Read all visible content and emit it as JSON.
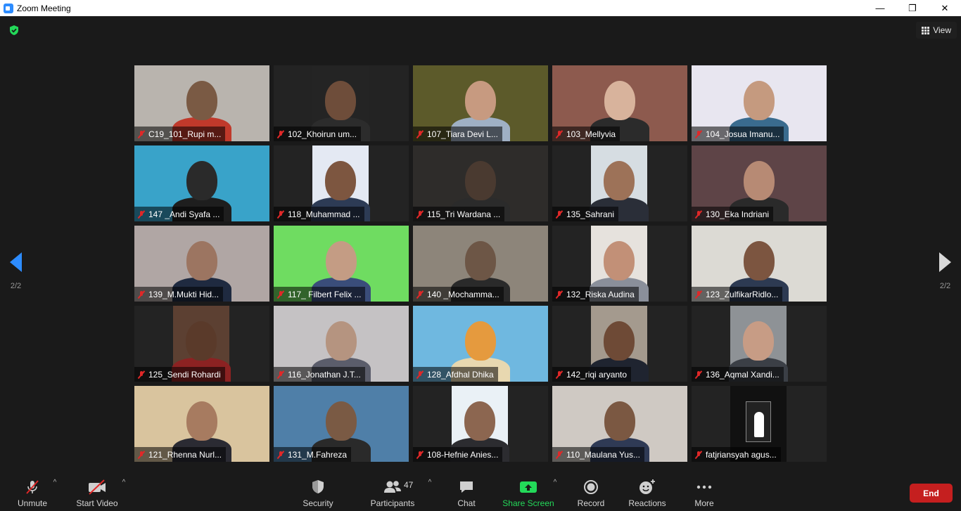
{
  "window": {
    "title": "Zoom Meeting",
    "minimize": "—",
    "restore": "❐",
    "close": "✕"
  },
  "top": {
    "view_label": "View"
  },
  "pagination": {
    "left": "2/2",
    "right": "2/2"
  },
  "participants": [
    {
      "name": "C19_101_Rupi m...",
      "bg": "#b9b4ae",
      "skin": "#7a5a44",
      "shirt": "#c0392b"
    },
    {
      "name": "102_Khoirun um...",
      "bg": "#242424",
      "skin": "#6e4d3a",
      "shirt": "#2c2c2c",
      "narrow": true
    },
    {
      "name": "107_Tiara Devi L...",
      "bg": "#5c5a2a",
      "skin": "#c79a80",
      "shirt": "#9fb0c4"
    },
    {
      "name": "103_Mellyvia",
      "bg": "#8d5a4e",
      "skin": "#d8b39c",
      "shirt": "#2b2b2b"
    },
    {
      "name": "104_Josua Imanu...",
      "bg": "#e8e6f0",
      "skin": "#c59a7f",
      "shirt": "#3a6b8e"
    },
    {
      "name": "147 _Andi Syafa ...",
      "bg": "#39a3c9",
      "skin": "#2a2a2a",
      "shirt": "#1e1e1e"
    },
    {
      "name": "118_Muhammad ...",
      "bg": "#e4e9f3",
      "skin": "#7d5640",
      "shirt": "#2d3b55",
      "narrow": true
    },
    {
      "name": "115_Tri Wardana ...",
      "bg": "#2e2c2a",
      "skin": "#4a3a30",
      "shirt": "#2b2b2b"
    },
    {
      "name": "135_Sahrani",
      "bg": "#d6dde2",
      "skin": "#9d7258",
      "shirt": "#2a2e38",
      "narrow": true
    },
    {
      "name": "130_Eka Indriani",
      "bg": "#5e4447",
      "skin": "#b78a74",
      "shirt": "#2a2a2a"
    },
    {
      "name": "139_M.Mukti Hid...",
      "bg": "#b0a6a4",
      "skin": "#9c7561",
      "shirt": "#1f2a40"
    },
    {
      "name": "117_ Filbert Felix ...",
      "bg": "#6fdc61",
      "skin": "#c49c84",
      "shirt": "#3a4d7a"
    },
    {
      "name": "140 _Mochamma...",
      "bg": "#8d857a",
      "skin": "#6d5646",
      "shirt": "#2a2a2a"
    },
    {
      "name": "132_Riska Audina",
      "bg": "#e6e2dd",
      "skin": "#c29077",
      "shirt": "#8a8f9a",
      "narrow": true
    },
    {
      "name": "123_ZulfikarRidlo...",
      "bg": "#dcdad4",
      "skin": "#7c5540",
      "shirt": "#2d3a52"
    },
    {
      "name": "125_Sendi Rohardi",
      "bg": "#5c4032",
      "skin": "#5a3a2a",
      "shirt": "#8c2222",
      "narrow": true
    },
    {
      "name": "116_Jonathan J.T...",
      "bg": "#c5c2c4",
      "skin": "#b59480",
      "shirt": "#5b5d6b"
    },
    {
      "name": "128_Afdhal Dhika",
      "bg": "#6fb8e0",
      "skin": "#e59a3e",
      "shirt": "#e8d8b0"
    },
    {
      "name": "142_riqi aryanto",
      "bg": "#a49a8e",
      "skin": "#6e4a36",
      "shirt": "#1f2430",
      "narrow": true
    },
    {
      "name": "136_Aqmal Xandi...",
      "bg": "#8e9296",
      "skin": "#c79c85",
      "shirt": "#3b3f46",
      "narrow": true
    },
    {
      "name": "121_Rhenna Nurl...",
      "bg": "#d9c49e",
      "skin": "#a77b60",
      "shirt": "#2b2b33"
    },
    {
      "name": "131_M.Fahreza",
      "bg": "#4f7fa8",
      "skin": "#7a5a44",
      "shirt": "#2a2a2a"
    },
    {
      "name": "108-Hefnie Anies...",
      "bg": "#eaf1f6",
      "skin": "#8c6650",
      "shirt": "#2c2c30",
      "narrow": true
    },
    {
      "name": "110_Maulana Yus...",
      "bg": "#cfc9c3",
      "skin": "#7b5842",
      "shirt": "#2f3a55"
    },
    {
      "name": "fatjriansyah agus...",
      "bg": "#111111",
      "skin": "#ffffff",
      "shirt": "#ffffff",
      "narrow": true,
      "poster": true
    }
  ],
  "toolbar": {
    "unmute": "Unmute",
    "start_video": "Start Video",
    "security": "Security",
    "participants": "Participants",
    "participants_count": "47",
    "chat": "Chat",
    "share_screen": "Share Screen",
    "record": "Record",
    "reactions": "Reactions",
    "more": "More",
    "end": "End"
  }
}
